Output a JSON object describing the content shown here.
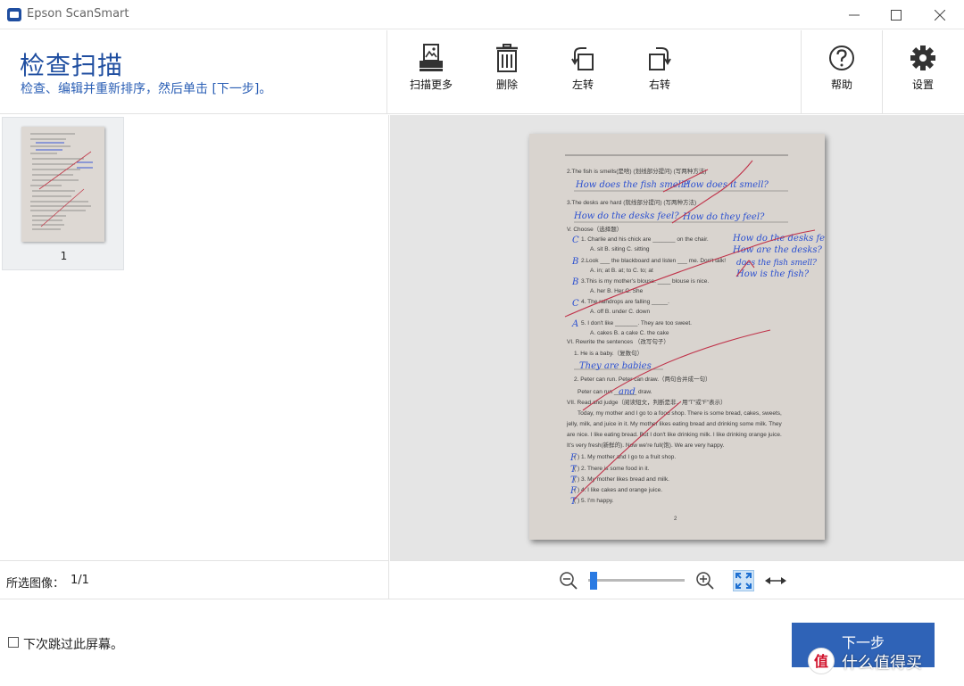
{
  "window": {
    "title": "Epson ScanSmart",
    "minimize": "—",
    "maximize": "☐",
    "close": "✕"
  },
  "header": {
    "title": "检查扫描",
    "subtitle": "检查、编辑并重新排序，然后单击 [下一步]。"
  },
  "toolbar": {
    "scan_more": "扫描更多",
    "delete": "删除",
    "rotate_left": "左转",
    "rotate_right": "右转",
    "help": "帮助",
    "settings": "设置"
  },
  "thumbnails": [
    {
      "page_number": "1"
    }
  ],
  "selection": {
    "label": "所选图像：",
    "value": "1/1"
  },
  "zoom": {
    "level": 0.02
  },
  "bottom": {
    "skip_label": "下次跳过此屏幕。",
    "skip_checked": false,
    "next_label": "下一步"
  },
  "watermark": {
    "glyph": "值",
    "text": "什么值得买"
  },
  "colors": {
    "accent": "#1f4ea0",
    "button": "#2f63b7",
    "preview_bg": "#e5e5e5"
  }
}
